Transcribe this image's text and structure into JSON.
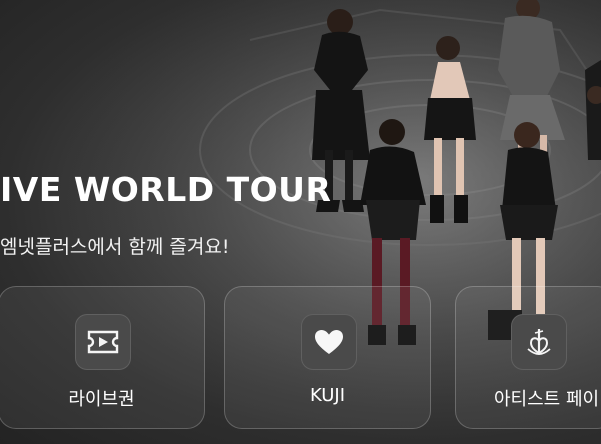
{
  "banner": {
    "title": "IVE WORLD TOUR",
    "subtitle": "엠넷플러스에서 함께 즐겨요!"
  },
  "menu": [
    {
      "label": "라이브권",
      "icon": "ticket-play-icon"
    },
    {
      "label": "KUJI",
      "icon": "heart-icon"
    },
    {
      "label": "아티스트 페이",
      "icon": "artist-logo-icon"
    }
  ]
}
